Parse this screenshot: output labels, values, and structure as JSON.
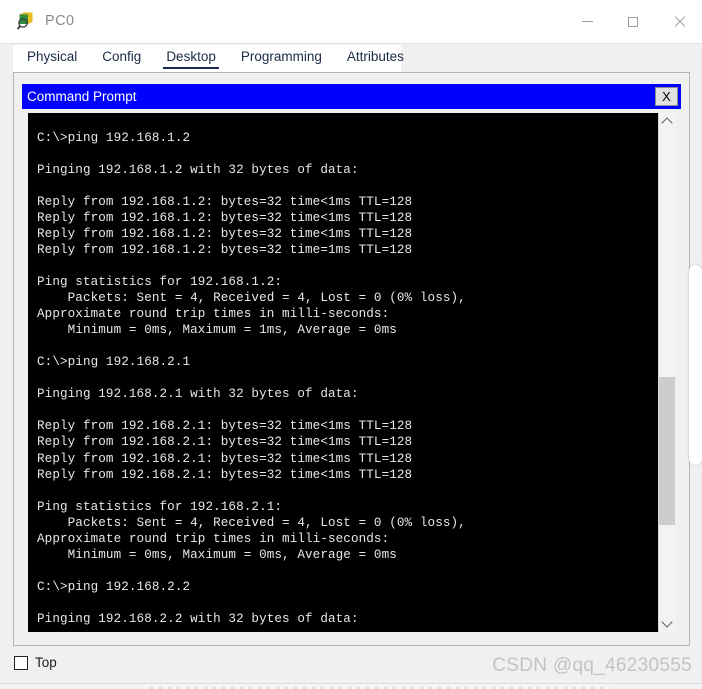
{
  "window": {
    "title": "PC0",
    "icon": "packet-tracer-pc-icon",
    "controls": {
      "minimize": "—",
      "maximize": "□",
      "close": "✕"
    }
  },
  "tabs": [
    {
      "label": "Physical",
      "active": false
    },
    {
      "label": "Config",
      "active": false
    },
    {
      "label": "Desktop",
      "active": true
    },
    {
      "label": "Programming",
      "active": false
    },
    {
      "label": "Attributes",
      "active": false
    }
  ],
  "command_prompt": {
    "title": "Command Prompt",
    "close_label": "X",
    "titlebar_color": "#0000ff",
    "terminal_bg": "#000000",
    "terminal_fg": "#e8e8e8",
    "scrollbar": {
      "up_arrow": "scroll-up-arrow",
      "down_arrow": "scroll-down-arrow",
      "thumb_top_pct": 51,
      "thumb_height_pct": 28
    },
    "terminal_output": "C:\\>ping 192.168.1.2\n\nPinging 192.168.1.2 with 32 bytes of data:\n\nReply from 192.168.1.2: bytes=32 time<1ms TTL=128\nReply from 192.168.1.2: bytes=32 time<1ms TTL=128\nReply from 192.168.1.2: bytes=32 time<1ms TTL=128\nReply from 192.168.1.2: bytes=32 time=1ms TTL=128\n\nPing statistics for 192.168.1.2:\n    Packets: Sent = 4, Received = 4, Lost = 0 (0% loss),\nApproximate round trip times in milli-seconds:\n    Minimum = 0ms, Maximum = 1ms, Average = 0ms\n\nC:\\>ping 192.168.2.1\n\nPinging 192.168.2.1 with 32 bytes of data:\n\nReply from 192.168.2.1: bytes=32 time<1ms TTL=128\nReply from 192.168.2.1: bytes=32 time<1ms TTL=128\nReply from 192.168.2.1: bytes=32 time<1ms TTL=128\nReply from 192.168.2.1: bytes=32 time<1ms TTL=128\n\nPing statistics for 192.168.2.1:\n    Packets: Sent = 4, Received = 4, Lost = 0 (0% loss),\nApproximate round trip times in milli-seconds:\n    Minimum = 0ms, Maximum = 0ms, Average = 0ms\n\nC:\\>ping 192.168.2.2\n\nPinging 192.168.2.2 with 32 bytes of data:"
  },
  "bottom": {
    "top_checkbox_label": "Top",
    "top_checkbox_checked": false
  },
  "watermark": "CSDN @qq_46230555"
}
